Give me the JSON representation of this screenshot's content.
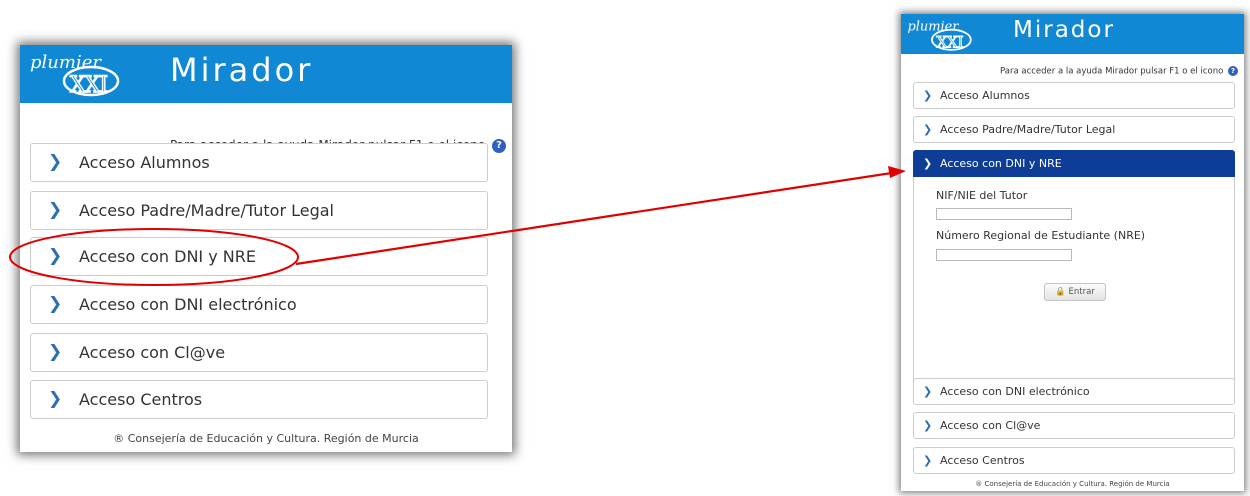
{
  "app": {
    "logo_text": "plumier",
    "title": "Mirador",
    "help_text": "Para acceder a la ayuda Mirador pulsar F1 o el icono",
    "help_icon_glyph": "?",
    "footer": "® Consejería de Educación y Cultura. Región de Murcia"
  },
  "menu": {
    "items": [
      {
        "label": "Acceso Alumnos"
      },
      {
        "label": "Acceso Padre/Madre/Tutor Legal"
      },
      {
        "label": "Acceso con DNI y NRE"
      },
      {
        "label": "Acceso con DNI electrónico"
      },
      {
        "label": "Acceso con Cl@ve"
      },
      {
        "label": "Acceso Centros"
      }
    ],
    "chevron": "❯",
    "active_index_right": 2
  },
  "dni_nre_form": {
    "tutor_label": "NIF/NIE del Tutor",
    "tutor_value": "",
    "nre_label": "Número Regional de Estudiante (NRE)",
    "nre_value": "",
    "submit_label": "🔒 Entrar"
  },
  "colors": {
    "header": "#1188d3",
    "active_item": "#0d3d96",
    "annotation": "#e00000",
    "chevron": "#2e6fb0"
  },
  "icons": [
    "chevron-right-icon",
    "help-icon",
    "lock-icon",
    "plumier-xxi-logo"
  ]
}
